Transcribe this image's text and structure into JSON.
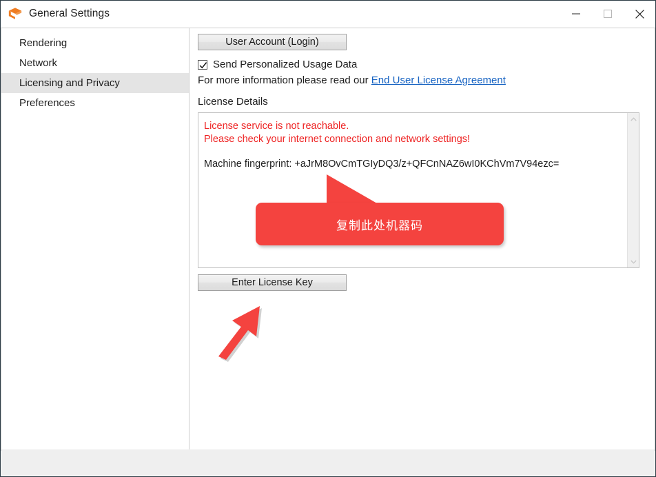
{
  "window": {
    "title": "General Settings",
    "app_icon": "enscape-logo-icon",
    "accent_color": "#ef7d22",
    "controls": {
      "minimize": "minimize-icon",
      "maximize": "maximize-icon",
      "close": "close-icon"
    }
  },
  "sidebar": {
    "items": [
      {
        "label": "Rendering",
        "selected": false
      },
      {
        "label": "Network",
        "selected": false
      },
      {
        "label": "Licensing and Privacy",
        "selected": true
      },
      {
        "label": "Preferences",
        "selected": false
      }
    ]
  },
  "panel": {
    "user_account_button": "User Account (Login)",
    "usage_data": {
      "label": "Send Personalized Usage Data",
      "checked": true
    },
    "info": {
      "prefix": "For more information please read our ",
      "link": "End User License Agreement"
    },
    "license_details": {
      "section_label": "License Details",
      "error_line_1": "License service is not reachable.",
      "error_line_2": "Please check your internet connection and network settings!",
      "error_color": "#ee2222",
      "fingerprint_label": "Machine fingerprint: ",
      "fingerprint_value": "+aJrM8OvCmTGIyDQ3/z+QFCnNAZ6wI0KChVm7V94ezc="
    },
    "enter_license_key_button": "Enter License Key"
  },
  "annotations": {
    "callout_text": "复制此处机器码",
    "callout_color": "#f4433f",
    "callout_pointer": "callout-pointer-icon",
    "arrow": "red-arrow-up-right-icon"
  }
}
